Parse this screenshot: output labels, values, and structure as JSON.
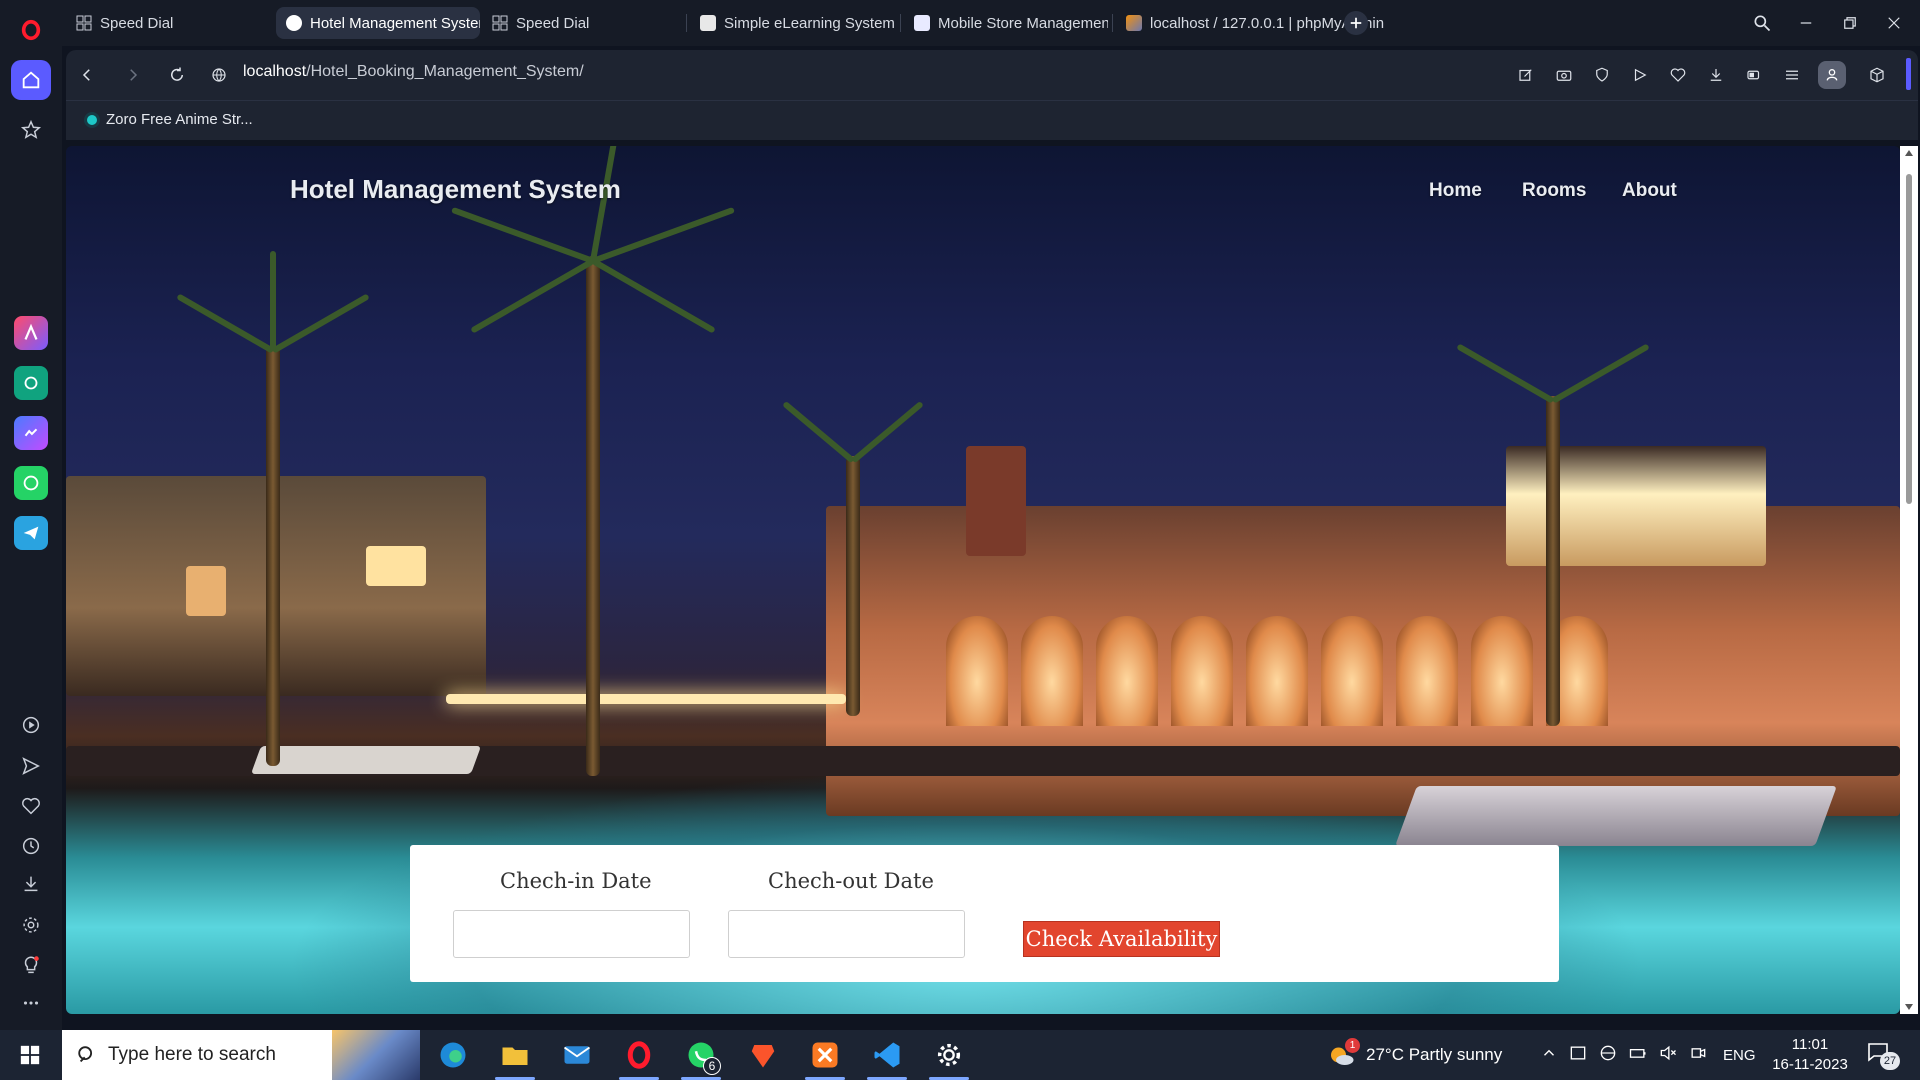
{
  "browser": {
    "tabs": [
      {
        "label": "Speed Dial",
        "active": false
      },
      {
        "label": "Hotel Management System",
        "active": true
      },
      {
        "label": "Speed Dial",
        "active": false
      },
      {
        "label": "Simple eLearning System",
        "active": false
      },
      {
        "label": "Mobile Store Management",
        "active": false
      },
      {
        "label": "localhost / 127.0.0.1 | phpMyAdmin",
        "active": false
      }
    ],
    "url_host": "localhost",
    "url_path": "/Hotel_Booking_Management_System/",
    "bookmark": "Zoro Free Anime Str..."
  },
  "page": {
    "brand": "Hotel Management System",
    "nav": {
      "home": "Home",
      "rooms": "Rooms",
      "about": "About"
    },
    "form": {
      "checkin_label": "Chech-in Date",
      "checkout_label": "Chech-out Date",
      "checkin_value": "",
      "checkout_value": "",
      "button": "Check Availability"
    }
  },
  "taskbar": {
    "search_placeholder": "Type here to search",
    "whatsapp_badge": "6",
    "weather_badge": "1",
    "weather": "27°C  Partly sunny",
    "lang": "ENG",
    "time": "11:01",
    "date": "16-11-2023",
    "notifications": "27"
  },
  "colors": {
    "accent_button": "#e2452e",
    "opera_red": "#ff1b2d",
    "active_home": "#5b5bff"
  }
}
